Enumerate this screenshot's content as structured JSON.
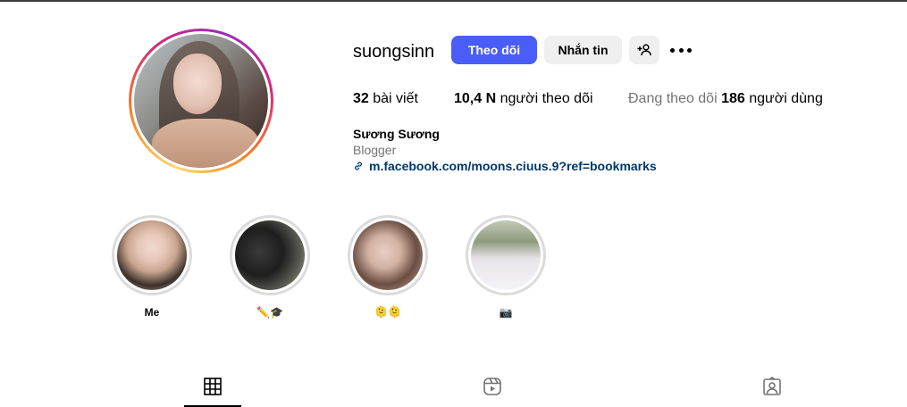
{
  "profile": {
    "username": "suongsinn",
    "full_name": "Sương Sương",
    "category": "Blogger",
    "link": "m.facebook.com/moons.ciuus.9?ref=bookmarks"
  },
  "actions": {
    "follow_label": "Theo dõi",
    "message_label": "Nhắn tin",
    "add_friend_icon": "add-person-icon",
    "more_icon": "more-options-icon"
  },
  "stats": {
    "posts_count": "32",
    "posts_label": "bài viết",
    "followers_count": "10,4 N",
    "followers_label": "người theo dõi",
    "following_prefix": "Đang theo dõi",
    "following_count": "186",
    "following_label": "người dùng"
  },
  "highlights": [
    {
      "label": "Me"
    },
    {
      "label": "✏️🎓"
    },
    {
      "label": "🫠🫠"
    },
    {
      "label": "📷"
    }
  ],
  "tabs": [
    {
      "icon": "grid-icon",
      "active": true
    },
    {
      "icon": "reels-icon",
      "active": false
    },
    {
      "icon": "tagged-icon",
      "active": false
    }
  ],
  "colors": {
    "follow_button": "#4a5df9",
    "link": "#00376b",
    "muted_text": "#737373",
    "secondary_button": "#efefef"
  }
}
